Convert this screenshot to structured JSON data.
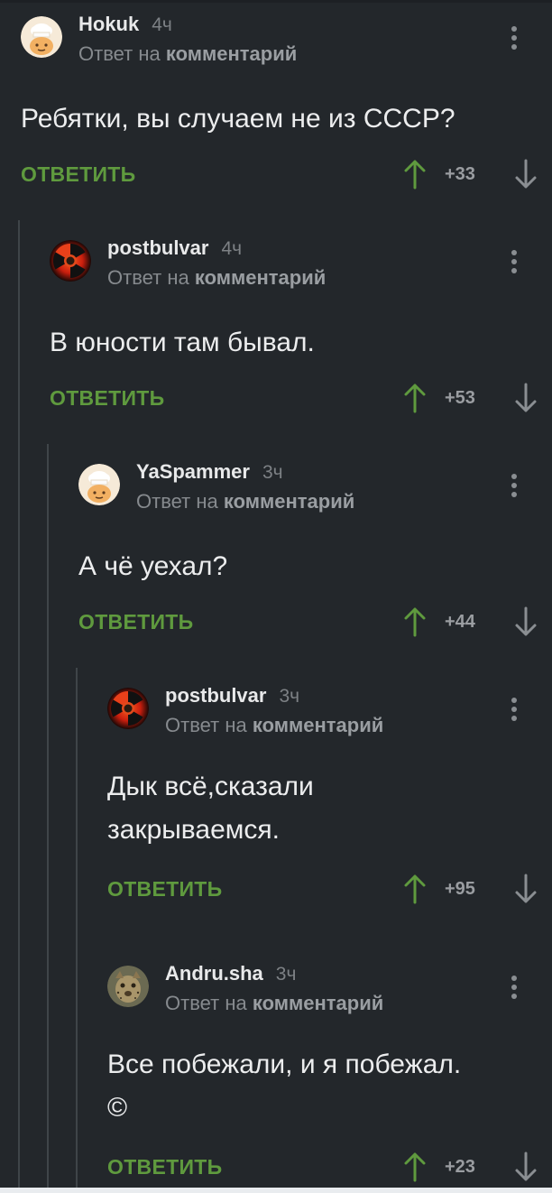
{
  "comments": [
    {
      "author": "Hokuk",
      "time": "4ч",
      "reply_prefix": "Ответ на",
      "reply_target": "комментарий",
      "text": "Ребятки, вы случаем не из СССР?",
      "reply_label": "ОТВЕТИТЬ",
      "score": "+33",
      "avatar": "default-chef-avatar"
    },
    {
      "author": "postbulvar",
      "time": "4ч",
      "reply_prefix": "Ответ на",
      "reply_target": "комментарий",
      "text": "В юности там бывал.",
      "reply_label": "ОТВЕТИТЬ",
      "score": "+53",
      "avatar": "radiation-avatar"
    },
    {
      "author": "YaSpammer",
      "time": "3ч",
      "reply_prefix": "Ответ на",
      "reply_target": "комментарий",
      "text": "А чё уехал?",
      "reply_label": "ОТВЕТИТЬ",
      "score": "+44",
      "avatar": "default-chef-avatar"
    },
    {
      "author": "postbulvar",
      "time": "3ч",
      "reply_prefix": "Ответ на",
      "reply_target": "комментарий",
      "text_lines": [
        "Дык всё,сказали",
        "закрываемся."
      ],
      "reply_label": "ОТВЕТИТЬ",
      "score": "+95",
      "avatar": "radiation-avatar"
    },
    {
      "author": "Andru.sha",
      "time": "3ч",
      "reply_prefix": "Ответ на",
      "reply_target": "комментарий",
      "text_lines": [
        "Все побежали, и я побежал.",
        "©"
      ],
      "reply_label": "ОТВЕТИТЬ",
      "score": "+23",
      "avatar": "photo-avatar"
    }
  ],
  "colors": {
    "background": "#23272b",
    "reply_green": "#5f9a3e",
    "upvote_green": "#5f9a3e",
    "muted": "#868a8e"
  }
}
